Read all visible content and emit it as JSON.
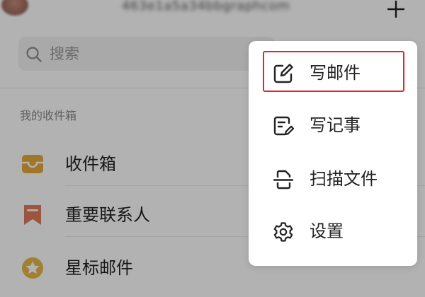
{
  "header": {
    "account": "463e1a5a34bbgraphcom",
    "add_icon": "plus-icon"
  },
  "search": {
    "placeholder": "搜索",
    "value": "",
    "icon": "search-icon"
  },
  "section": {
    "title": "我的收件箱"
  },
  "folders": [
    {
      "label": "收件箱",
      "icon": "inbox-icon",
      "color": "#E6A93A"
    },
    {
      "label": "重要联系人",
      "icon": "bookmark-icon",
      "color": "#E07B5C"
    },
    {
      "label": "星标邮件",
      "icon": "star-icon",
      "color": "#E8B84A"
    }
  ],
  "menu": {
    "items": [
      {
        "label": "写邮件",
        "icon": "compose-icon",
        "highlighted": true
      },
      {
        "label": "写记事",
        "icon": "note-icon"
      },
      {
        "label": "扫描文件",
        "icon": "scan-icon"
      },
      {
        "label": "设置",
        "icon": "settings-icon"
      }
    ]
  },
  "colors": {
    "highlight": "#E0282C",
    "overlay": "rgba(0,0,0,0.30)"
  }
}
